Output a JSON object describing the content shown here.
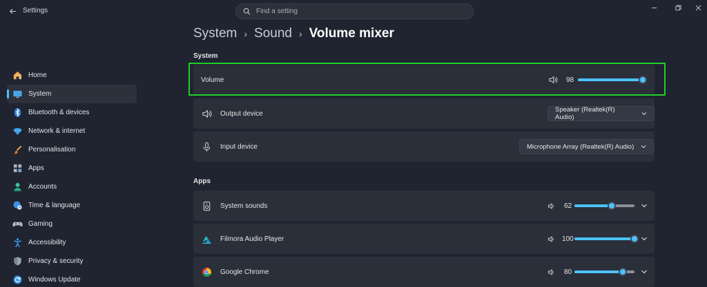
{
  "window": {
    "title": "Settings",
    "search_placeholder": "Find a setting"
  },
  "sidebar": {
    "items": [
      {
        "label": "Home",
        "icon": "home-icon"
      },
      {
        "label": "System",
        "icon": "system-icon",
        "selected": true
      },
      {
        "label": "Bluetooth & devices",
        "icon": "bluetooth-icon"
      },
      {
        "label": "Network & internet",
        "icon": "wifi-icon"
      },
      {
        "label": "Personalisation",
        "icon": "brush-icon"
      },
      {
        "label": "Apps",
        "icon": "apps-icon"
      },
      {
        "label": "Accounts",
        "icon": "account-icon"
      },
      {
        "label": "Time & language",
        "icon": "globe-clock-icon"
      },
      {
        "label": "Gaming",
        "icon": "gamepad-icon"
      },
      {
        "label": "Accessibility",
        "icon": "accessibility-icon"
      },
      {
        "label": "Privacy & security",
        "icon": "shield-icon"
      },
      {
        "label": "Windows Update",
        "icon": "update-icon"
      }
    ]
  },
  "breadcrumb": [
    "System",
    "Sound",
    "Volume mixer"
  ],
  "system_section": {
    "label": "System",
    "volume": {
      "label": "Volume",
      "value": "98",
      "level": 98
    },
    "output": {
      "label": "Output device",
      "value": "Speaker (Realtek(R) Audio)"
    },
    "input": {
      "label": "Input device",
      "value": "Microphone Array (Realtek(R) Audio)"
    }
  },
  "apps_section": {
    "label": "Apps",
    "apps": [
      {
        "name": "System sounds",
        "value": "62",
        "level": 62,
        "icon": "speaker-box-icon"
      },
      {
        "name": "Filmora Audio Player",
        "value": "100",
        "level": 100,
        "icon": "filmora-icon"
      },
      {
        "name": "Google Chrome",
        "value": "80",
        "level": 80,
        "icon": "chrome-icon"
      }
    ]
  },
  "colors": {
    "accent": "#4cc2ff",
    "highlight": "#1fd12a",
    "background": "#1f2430",
    "card": "#2a2f39"
  }
}
